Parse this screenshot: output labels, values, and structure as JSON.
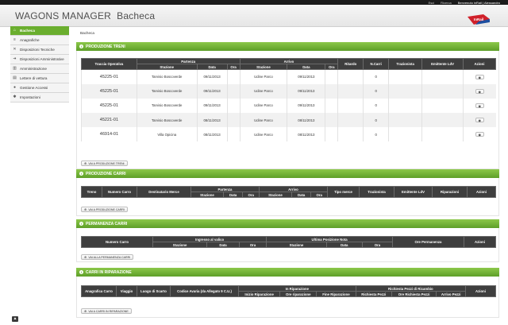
{
  "topbar": {
    "esci": "Esci",
    "ricerca": "Ricerca",
    "welcome": "Benvenuto inRail | Alessandro"
  },
  "app": {
    "title": "WAGONS MANAGER",
    "subtitle": "Bacheca",
    "logo_text": "InRail"
  },
  "sidebar": {
    "items": [
      {
        "label": "Bacheca",
        "icon": "home-icon"
      },
      {
        "label": "Anagrafiche",
        "icon": "list-icon"
      },
      {
        "label": "Disposizioni Tecniche",
        "icon": "wrench-icon"
      },
      {
        "label": "Disposizioni Amministrative",
        "icon": "arrow-icon"
      },
      {
        "label": "Amministrazione",
        "icon": "chart-icon"
      },
      {
        "label": "Lettere di vettura",
        "icon": "document-icon"
      },
      {
        "label": "Gestione Accessi",
        "icon": "user-icon"
      },
      {
        "label": "Impostazioni",
        "icon": "settings-icon"
      }
    ]
  },
  "breadcrumb": "Bacheca",
  "treni": {
    "title": "Produzione Treni",
    "group_headers": {
      "partenza": "Partenza",
      "arrivo": "Arrivo"
    },
    "headers": {
      "traccia": "Traccia Operativa",
      "stazione": "Stazione",
      "data": "Data",
      "ora": "Ora",
      "ritardo": "Ritardo",
      "ncarri": "N.Carri",
      "trazionista": "Trazionista",
      "emittente": "Emittente LdV",
      "azioni": "Azioni"
    },
    "rows": [
      {
        "code": "45225-01",
        "dep_station": "Tarvisio Boscoverde",
        "dep_date": "09/11/2013",
        "dep_time": "",
        "arr_station": "Udine Parco",
        "arr_date": "09/11/2013",
        "arr_time": "",
        "delay": "",
        "cars": "0",
        "trazionista": "",
        "emittente": ""
      },
      {
        "code": "45225-01",
        "dep_station": "Tarvisio Boscoverde",
        "dep_date": "09/11/2013",
        "dep_time": "",
        "arr_station": "Udine Parco",
        "arr_date": "09/11/2013",
        "arr_time": "",
        "delay": "",
        "cars": "0",
        "trazionista": "",
        "emittente": ""
      },
      {
        "code": "45225-01",
        "dep_station": "Tarvisio Boscoverde",
        "dep_date": "09/11/2013",
        "dep_time": "",
        "arr_station": "Udine Parco",
        "arr_date": "09/11/2013",
        "arr_time": "",
        "delay": "",
        "cars": "0",
        "trazionista": "",
        "emittente": ""
      },
      {
        "code": "45221-01",
        "dep_station": "Tarvisio Boscoverde",
        "dep_date": "08/11/2013",
        "dep_time": "",
        "arr_station": "Udine Parco",
        "arr_date": "08/11/2013",
        "arr_time": "",
        "delay": "",
        "cars": "0",
        "trazionista": "",
        "emittente": ""
      },
      {
        "code": "46914-01",
        "dep_station": "Villa Opicina",
        "dep_date": "08/11/2013",
        "dep_time": "",
        "arr_station": "Udine Parco",
        "arr_date": "08/11/2013",
        "arr_time": "",
        "delay": "",
        "cars": "0",
        "trazionista": "",
        "emittente": ""
      }
    ],
    "button": "Vai a produzione treni"
  },
  "carri": {
    "title": "Produzione Carri",
    "group_headers": {
      "partenza": "Partenza",
      "arrivo": "Arrivo"
    },
    "headers": {
      "treno": "Treno",
      "numero": "Numero Carro",
      "destinatario": "Destinatario Merce",
      "stazione": "Stazione",
      "data": "Data",
      "ora": "Ora",
      "tipo": "Tipo merce",
      "trazionista": "Trazionista",
      "emittente": "Emittente LdV",
      "riparazioni": "Riparazioni",
      "azioni": "Azioni"
    },
    "button": "Vai a produzione carri"
  },
  "permanenza": {
    "title": "Permanenza Carri",
    "group_headers": {
      "ingresso": "Ingresso al valico",
      "ultima": "Ultima Posizione Nota"
    },
    "headers": {
      "numero": "Numero Carro",
      "stazione": "Stazione",
      "data": "Data",
      "ora": "Ora",
      "ore": "Ore Permanenza",
      "azioni": "Azioni"
    },
    "button": "Vai alla permanenza carri"
  },
  "riparazione": {
    "title": "Carri in Riparazione",
    "group_headers": {
      "in_rip": "In Riparazione",
      "richiesta": "Richiesta Pezzi di Ricambio"
    },
    "headers": {
      "anagrafica": "Anagrafica Carro",
      "viaggio": "Viaggio",
      "luogo": "Luogo di Scarto",
      "codice": "Codice Avaria (da Allegato 9 C.U.)",
      "inizio": "Inizio Riparazione",
      "ore_rip": "Ore riparazione",
      "fine": "Fine Riparazione",
      "richiesta_pezzi": "Richiesta Pezzi",
      "ore_richiesta": "Ore Richiesta Pezzi",
      "arrivo": "Arrivo Pezzi",
      "azioni": "Azioni"
    },
    "button": "Vai a carri in riparazione"
  },
  "colors": {
    "accent": "#6aae2e",
    "header_dark": "#3e3e3e",
    "brand_red": "#d0202a",
    "brand_blue": "#1d4fa0"
  }
}
